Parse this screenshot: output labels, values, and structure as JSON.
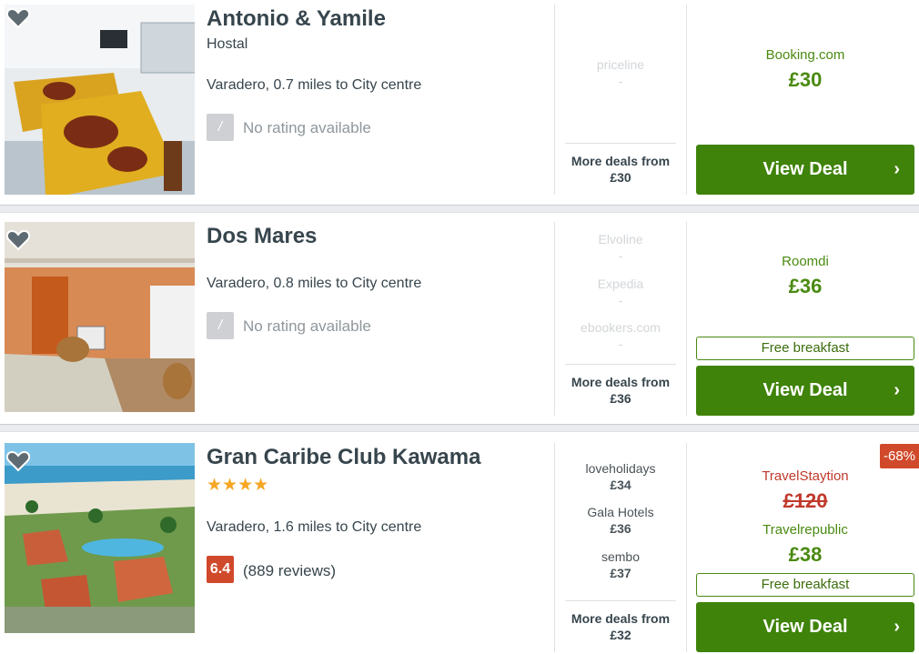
{
  "hotels": [
    {
      "name": "Antonio & Yamile",
      "type": "Hostal",
      "location": "Varadero, 0.7 miles to City centre",
      "rating_icon": "/",
      "rating_text": "No rating available",
      "other_deals": [
        {
          "provider": "priceline",
          "price": "-"
        }
      ],
      "more_deals_label": "More deals from",
      "more_deals_price": "£30",
      "provider": "Booking.com",
      "price": "£30",
      "button": "View Deal",
      "button_icon": "chevron-right"
    },
    {
      "name": "Dos Mares",
      "location": "Varadero, 0.8 miles to City centre",
      "rating_icon": "/",
      "rating_text": "No rating available",
      "other_deals": [
        {
          "provider": "Elvoline",
          "price": "-"
        },
        {
          "provider": "Expedia",
          "price": "-"
        },
        {
          "provider": "ebookers.com",
          "price": "-"
        }
      ],
      "more_deals_label": "More deals from",
      "more_deals_price": "£36",
      "provider": "Roomdi",
      "price": "£36",
      "perk": "Free breakfast",
      "button": "View Deal",
      "button_icon": "chevron-right"
    },
    {
      "name": "Gran Caribe Club Kawama",
      "stars": "★★★★",
      "star_count": 4,
      "location": "Varadero, 1.6 miles to City centre",
      "score": "6.4",
      "reviews": "(889 reviews)",
      "other_deals": [
        {
          "provider": "loveholidays",
          "price": "£34"
        },
        {
          "provider": "Gala Hotels",
          "price": "£36"
        },
        {
          "provider": "sembo",
          "price": "£37"
        }
      ],
      "more_deals_label": "More deals from",
      "more_deals_price": "£32",
      "discount": "-68%",
      "old_provider": "TravelStaytion",
      "old_price": "£120",
      "provider": "Travelrepublic",
      "price": "£38",
      "perk": "Free breakfast",
      "button": "View Deal",
      "button_icon": "chevron-right"
    }
  ],
  "colors": {
    "deal_green": "#3f830a",
    "price_green": "#4a8a11",
    "score_red": "#d0492b",
    "star_orange": "#f5a623"
  }
}
